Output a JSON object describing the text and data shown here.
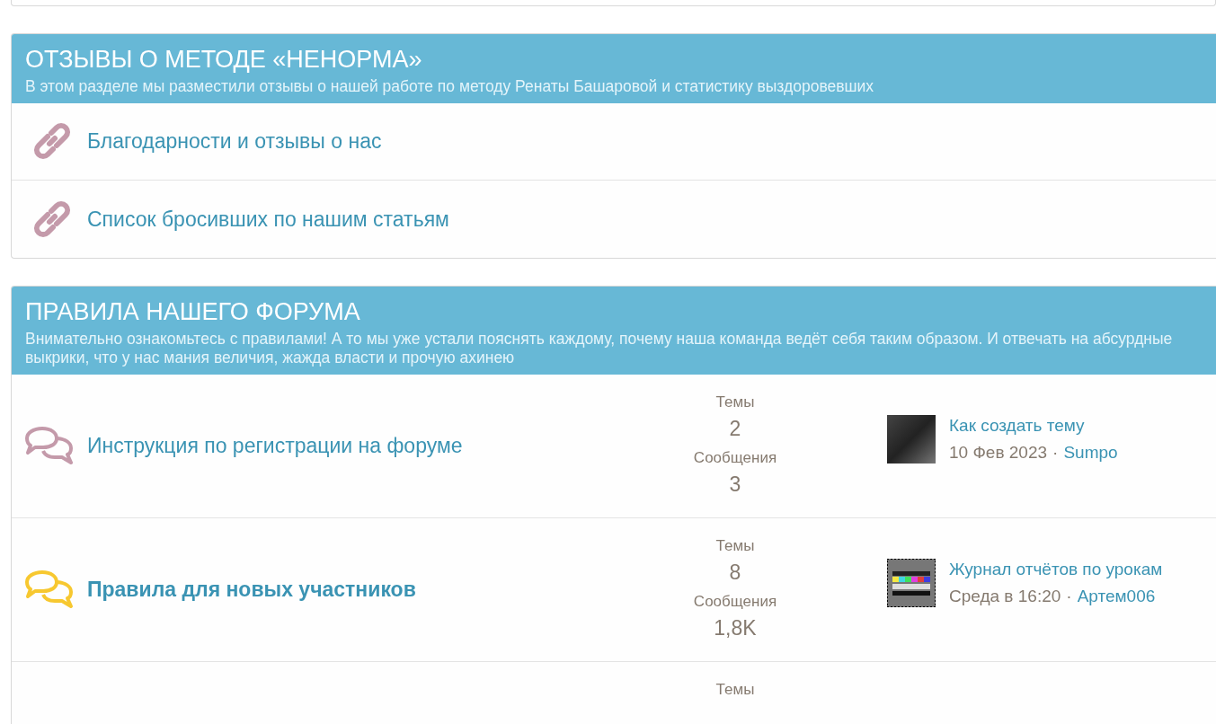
{
  "categories": [
    {
      "title": "ОТЗЫВЫ О МЕТОДЕ «НЕНОРМА»",
      "description": "В этом разделе мы разместили отзывы о нашей работе по методу Ренаты Башаровой и статистику выздоровевших",
      "nodes": [
        {
          "kind": "link",
          "title": "Благодарности и отзывы о нас"
        },
        {
          "kind": "link",
          "title": "Список бросивших по нашим статьям"
        }
      ]
    },
    {
      "title": "ПРАВИЛА НАШЕГО ФОРУМА",
      "description": "Внимательно ознакомьтесь с правилами! А то мы уже устали пояснять каждому, почему наша команда ведёт себя таким образом. И отвечать на абсурдные выкрики, что у нас мания величия, жажда власти и прочую ахинею",
      "nodes": [
        {
          "kind": "forum",
          "title": "Инструкция по регистрации на форуме",
          "unread": false,
          "threads_label": "Темы",
          "threads": "2",
          "messages_label": "Сообщения",
          "messages": "3",
          "last_post": {
            "kind": "photo",
            "title": "Как создать тему",
            "date": "10 Фев 2023",
            "separator": "·",
            "author": "Sumpo"
          }
        },
        {
          "kind": "forum",
          "title": "Правила для новых участников",
          "unread": true,
          "threads_label": "Темы",
          "threads": "8",
          "messages_label": "Сообщения",
          "messages": "1,8K",
          "last_post": {
            "kind": "pattern",
            "title": "Журнал отчётов по урокам",
            "date": "Среда в 16:20",
            "separator": "·",
            "author": "Артем006"
          }
        },
        {
          "kind": "forum",
          "threads_label": "Темы"
        }
      ]
    }
  ]
}
